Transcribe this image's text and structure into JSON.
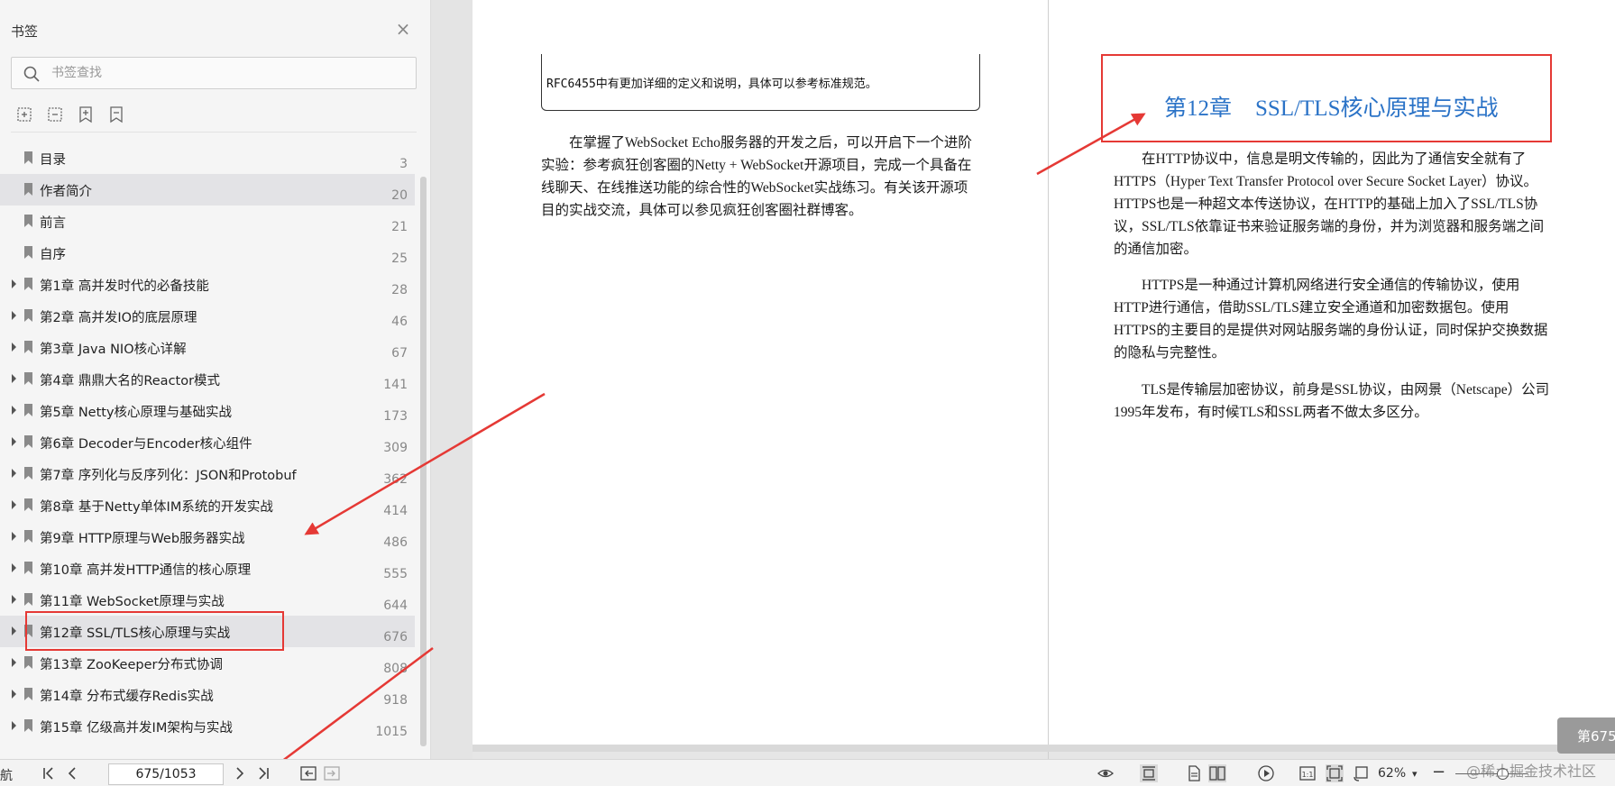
{
  "sidebar": {
    "title": "书签",
    "search_placeholder": "书签查找",
    "items": [
      {
        "label": "目录",
        "page": "3",
        "has_children": false
      },
      {
        "label": "作者简介",
        "page": "20",
        "has_children": false
      },
      {
        "label": "前言",
        "page": "21",
        "has_children": false
      },
      {
        "label": "自序",
        "page": "25",
        "has_children": false
      },
      {
        "label": "第1章 高并发时代的必备技能",
        "page": "28",
        "has_children": true
      },
      {
        "label": "第2章 高并发IO的底层原理",
        "page": "46",
        "has_children": true
      },
      {
        "label": "第3章 Java NIO核心详解",
        "page": "67",
        "has_children": true
      },
      {
        "label": "第4章 鼎鼎大名的Reactor模式",
        "page": "141",
        "has_children": true
      },
      {
        "label": "第5章 Netty核心原理与基础实战",
        "page": "173",
        "has_children": true
      },
      {
        "label": "第6章 Decoder与Encoder核心组件",
        "page": "309",
        "has_children": true
      },
      {
        "label": "第7章 序列化与反序列化：JSON和Protobuf",
        "page": "362",
        "has_children": true
      },
      {
        "label": "第8章 基于Netty单体IM系统的开发实战",
        "page": "414",
        "has_children": true
      },
      {
        "label": "第9章 HTTP原理与Web服务器实战",
        "page": "486",
        "has_children": true
      },
      {
        "label": "第10章 高并发HTTP通信的核心原理",
        "page": "555",
        "has_children": true
      },
      {
        "label": "第11章 WebSocket原理与实战",
        "page": "644",
        "has_children": true
      },
      {
        "label": "第12章 SSL/TLS核心原理与实战",
        "page": "676",
        "has_children": true
      },
      {
        "label": "第13章 ZooKeeper分布式协调",
        "page": "808",
        "has_children": true
      },
      {
        "label": "第14章 分布式缓存Redis实战",
        "page": "918",
        "has_children": true
      },
      {
        "label": "第15章 亿级高并发IM架构与实战",
        "page": "1015",
        "has_children": true
      }
    ]
  },
  "left_page": {
    "note": "RFC6455中有更加详细的定义和说明，具体可以参考标准规范。",
    "paragraph_lines": [
      "　　在掌握了WebSocket Echo服务器的开发之后，可以开启下一个进阶",
      "实验：参考疯狂创客圈的Netty + WebSocket开源项目，完成一个具备在",
      "线聊天、在线推送功能的综合性的WebSocket实战练习。有关该开源项",
      "目的实战交流，具体可以参见疯狂创客圈社群博客。"
    ]
  },
  "right_page": {
    "chapter_no": "第12章",
    "chapter_title": "SSL/TLS核心原理与实战",
    "paragraphs": [
      [
        "　　在HTTP协议中，信息是明文传输的，因此为了通信安全就有了",
        "HTTPS（Hyper Text Transfer Protocol over Secure Socket Layer）协议。",
        "HTTPS也是一种超文本传送协议，在HTTP的基础上加入了SSL/TLS协",
        "议，SSL/TLS依靠证书来验证服务端的身份，并为浏览器和服务端之间",
        "的通信加密。"
      ],
      [
        "　　HTTPS是一种通过计算机网络进行安全通信的传输协议，使用",
        "HTTP进行通信，借助SSL/TLS建立安全通道和加密数据包。使用",
        "HTTPS的主要目的是提供对网站服务端的身份认证，同时保护交换数据",
        "的隐私与完整性。"
      ],
      [
        "　　TLS是传输层加密协议，前身是SSL协议，由网景（Netscape）公司",
        "1995年发布，有时候TLS和SSL两者不做太多区分。"
      ]
    ]
  },
  "page_badge": "第675",
  "toolbar": {
    "nav_label": "航",
    "page_value": "675/1053",
    "zoom": "62%",
    "zoom_arrow": "▾",
    "zoom_minus": "−"
  },
  "watermark": "@稀土掘金技术社区",
  "colors": {
    "accent_red": "#e53935",
    "chapter_blue": "#2b73c7",
    "highlight_row": "#e3e3e6"
  }
}
